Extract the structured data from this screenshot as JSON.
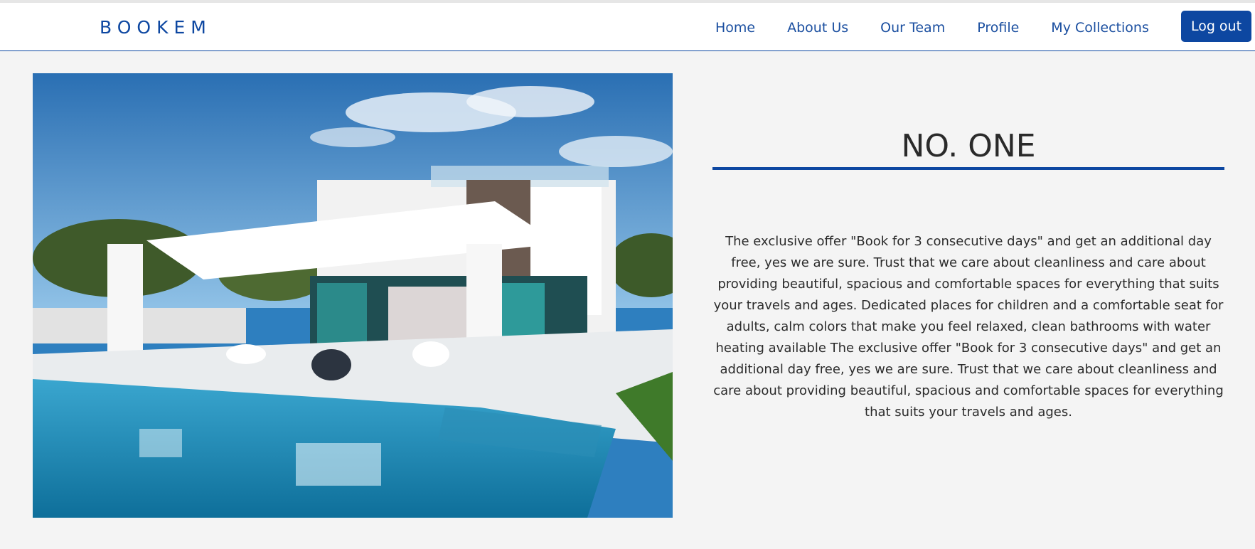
{
  "navbar": {
    "brand": "BOOKEM",
    "links": [
      {
        "label": "Home"
      },
      {
        "label": "About Us"
      },
      {
        "label": "Our Team"
      },
      {
        "label": "Profile"
      },
      {
        "label": "My Collections"
      }
    ],
    "logout_label": "Log out"
  },
  "hero": {
    "image_icon": "modern-villa-with-pool-photo"
  },
  "main": {
    "title": "NO. ONE",
    "description": "The exclusive offer \"Book for 3 consecutive days\" and get an additional day free, yes we are sure. Trust that we care about cleanliness and care about providing beautiful, spacious and comfortable spaces for everything that suits your travels and ages. Dedicated places for children and a comfortable seat for adults, calm colors that make you feel relaxed, clean bathrooms with water heating available The exclusive offer \"Book for 3 consecutive days\" and get an additional day free, yes we are sure. Trust that we care about cleanliness and care about providing beautiful, spacious and comfortable spaces for everything that suits your travels and ages."
  },
  "colors": {
    "brand_blue": "#0d47a1",
    "link_blue": "#1b4fa0",
    "background": "#f4f4f4"
  }
}
